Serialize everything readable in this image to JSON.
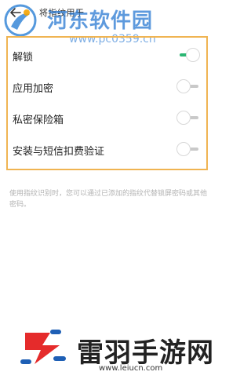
{
  "header": {
    "title": "将指纹用于"
  },
  "options": [
    {
      "label": "解锁",
      "enabled": true
    },
    {
      "label": "应用加密",
      "enabled": false
    },
    {
      "label": "私密保险箱",
      "enabled": false
    },
    {
      "label": "安装与短信扣费验证",
      "enabled": false
    }
  ],
  "hint": {
    "text": "使用指纹识别时，您可以通过已添加的指纹代替锁屏密码或其他密码。"
  },
  "watermark_top": {
    "name": "河东软件园",
    "url": "www.pc0359.cn"
  },
  "watermark_bottom": {
    "name": "雷羽手游网",
    "url": "www.leiucn.com"
  },
  "colors": {
    "highlight_border": "#f0b452",
    "switch_on": "#2bb673",
    "switch_off": "#c9c9c9"
  },
  "icons": {
    "back": "back-arrow-icon"
  }
}
